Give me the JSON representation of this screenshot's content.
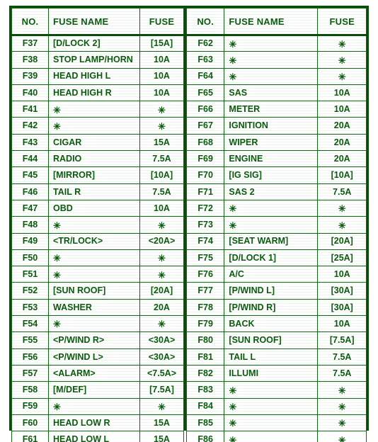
{
  "document": {
    "type": "fuse-box-chart",
    "colors": {
      "text": "#0b5c0e",
      "grid_line": "#0f6b12",
      "outer_border": "#0a4d0a",
      "background": "#ffffff"
    },
    "empty_marker": "✳"
  },
  "tables": [
    {
      "id": "left",
      "headers": {
        "no": "NO.",
        "name": "FUSE NAME",
        "fuse": "FUSE"
      },
      "rows": [
        {
          "no": "F37",
          "name": "[D/LOCK 2]",
          "fuse": "[15A]"
        },
        {
          "no": "F38",
          "name": "STOP LAMP/HORN",
          "fuse": "10A"
        },
        {
          "no": "F39",
          "name": "HEAD HIGH L",
          "fuse": "10A"
        },
        {
          "no": "F40",
          "name": "HEAD HIGH R",
          "fuse": "10A"
        },
        {
          "no": "F41",
          "name": "✳",
          "fuse": "✳"
        },
        {
          "no": "F42",
          "name": "✳",
          "fuse": "✳"
        },
        {
          "no": "F43",
          "name": "CIGAR",
          "fuse": "15A"
        },
        {
          "no": "F44",
          "name": "RADIO",
          "fuse": "7.5A"
        },
        {
          "no": "F45",
          "name": "[MIRROR]",
          "fuse": "[10A]"
        },
        {
          "no": "F46",
          "name": "TAIL R",
          "fuse": "7.5A"
        },
        {
          "no": "F47",
          "name": "OBD",
          "fuse": "10A"
        },
        {
          "no": "F48",
          "name": "✳",
          "fuse": "✳"
        },
        {
          "no": "F49",
          "name": "<TR/LOCK>",
          "fuse": "<20A>"
        },
        {
          "no": "F50",
          "name": "✳",
          "fuse": "✳"
        },
        {
          "no": "F51",
          "name": "✳",
          "fuse": "✳"
        },
        {
          "no": "F52",
          "name": "[SUN ROOF]",
          "fuse": "[20A]"
        },
        {
          "no": "F53",
          "name": "WASHER",
          "fuse": "20A"
        },
        {
          "no": "F54",
          "name": "✳",
          "fuse": "✳"
        },
        {
          "no": "F55",
          "name": "<P/WIND R>",
          "fuse": "<30A>"
        },
        {
          "no": "F56",
          "name": "<P/WIND L>",
          "fuse": "<30A>"
        },
        {
          "no": "F57",
          "name": "<ALARM>",
          "fuse": "<7.5A>"
        },
        {
          "no": "F58",
          "name": "[M/DEF]",
          "fuse": "[7.5A]"
        },
        {
          "no": "F59",
          "name": "✳",
          "fuse": "✳"
        },
        {
          "no": "F60",
          "name": "HEAD LOW R",
          "fuse": "15A"
        },
        {
          "no": "F61",
          "name": "HEAD LOW L",
          "fuse": "15A"
        }
      ]
    },
    {
      "id": "right",
      "headers": {
        "no": "NO.",
        "name": "FUSE NAME",
        "fuse": "FUSE"
      },
      "rows": [
        {
          "no": "F62",
          "name": "✳",
          "fuse": "✳"
        },
        {
          "no": "F63",
          "name": "✳",
          "fuse": "✳"
        },
        {
          "no": "F64",
          "name": "✳",
          "fuse": "✳"
        },
        {
          "no": "F65",
          "name": "SAS",
          "fuse": "10A"
        },
        {
          "no": "F66",
          "name": "METER",
          "fuse": "10A"
        },
        {
          "no": "F67",
          "name": "IGNITION",
          "fuse": "20A"
        },
        {
          "no": "F68",
          "name": "WIPER",
          "fuse": "20A"
        },
        {
          "no": "F69",
          "name": "ENGINE",
          "fuse": "20A"
        },
        {
          "no": "F70",
          "name": "[IG SIG]",
          "fuse": "[10A]"
        },
        {
          "no": "F71",
          "name": "SAS 2",
          "fuse": "7.5A"
        },
        {
          "no": "F72",
          "name": "✳",
          "fuse": "✳"
        },
        {
          "no": "F73",
          "name": "✳",
          "fuse": "✳"
        },
        {
          "no": "F74",
          "name": "[SEAT WARM]",
          "fuse": "[20A]"
        },
        {
          "no": "F75",
          "name": "[D/LOCK 1]",
          "fuse": "[25A]"
        },
        {
          "no": "F76",
          "name": "A/C",
          "fuse": "10A"
        },
        {
          "no": "F77",
          "name": "[P/WIND L]",
          "fuse": "[30A]"
        },
        {
          "no": "F78",
          "name": "[P/WIND R]",
          "fuse": "[30A]"
        },
        {
          "no": "F79",
          "name": "BACK",
          "fuse": "10A"
        },
        {
          "no": "F80",
          "name": "[SUN ROOF]",
          "fuse": "[7.5A]"
        },
        {
          "no": "F81",
          "name": "TAIL L",
          "fuse": "7.5A"
        },
        {
          "no": "F82",
          "name": "ILLUMI",
          "fuse": "7.5A"
        },
        {
          "no": "F83",
          "name": "✳",
          "fuse": "✳"
        },
        {
          "no": "F84",
          "name": "✳",
          "fuse": "✳"
        },
        {
          "no": "F85",
          "name": "✳",
          "fuse": "✳"
        },
        {
          "no": "F86",
          "name": "✳",
          "fuse": "✳"
        }
      ]
    }
  ]
}
